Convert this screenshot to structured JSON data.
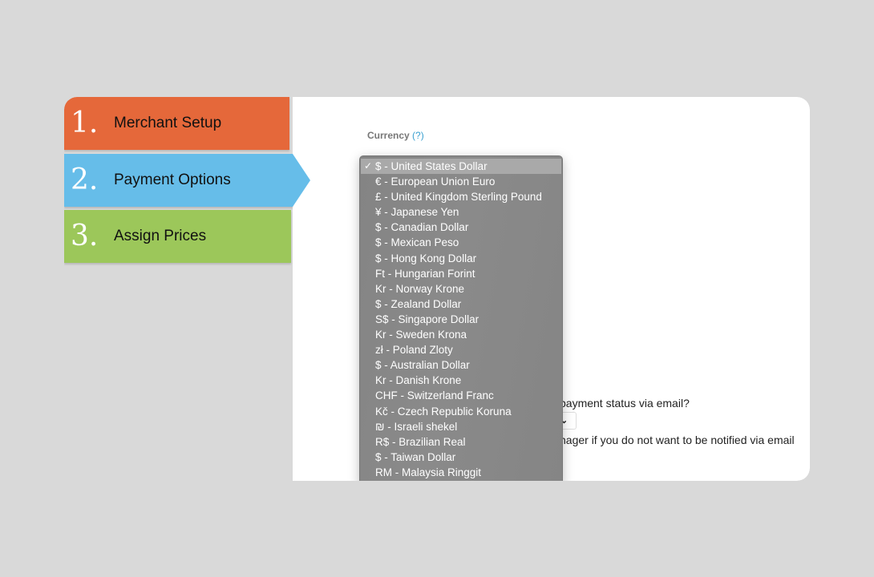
{
  "steps": [
    {
      "number": "1.",
      "label": "Merchant Setup",
      "color": "#e5683a",
      "active": false
    },
    {
      "number": "2.",
      "label": "Payment Options",
      "color": "#66bde9",
      "active": true
    },
    {
      "number": "3.",
      "label": "Assign Prices",
      "color": "#9cc75a",
      "active": false
    }
  ],
  "currency": {
    "label": "Currency",
    "help": "(?)",
    "selected_index": 0,
    "check_icon": "✓",
    "options": [
      "$ - United States Dollar",
      "€ - European Union Euro",
      "£ - United Kingdom Sterling Pound",
      "¥ - Japanese Yen",
      "$ - Canadian Dollar",
      "$ - Mexican Peso",
      "$ - Hong Kong Dollar",
      "Ft - Hungarian Forint",
      "Kr - Norway Krone",
      "$ - Zealand Dollar",
      "S$ - Singapore Dollar",
      "Kr - Sweden Krona",
      "zł - Poland Zloty",
      "$ - Australian Dollar",
      "Kr - Danish Krone",
      "CHF - Switzerland Franc",
      "Kč - Czech Republic Koruna",
      "₪ - Israeli shekel",
      "R$ - Brazilian Real",
      "$ - Taiwan Dollar",
      "RM - Malaysia Ringgit"
    ]
  },
  "notify": {
    "question_partial": "payment status via email?",
    "select_chevron": "⌄",
    "note_partial": "nager if you do not want to be notified via email"
  }
}
